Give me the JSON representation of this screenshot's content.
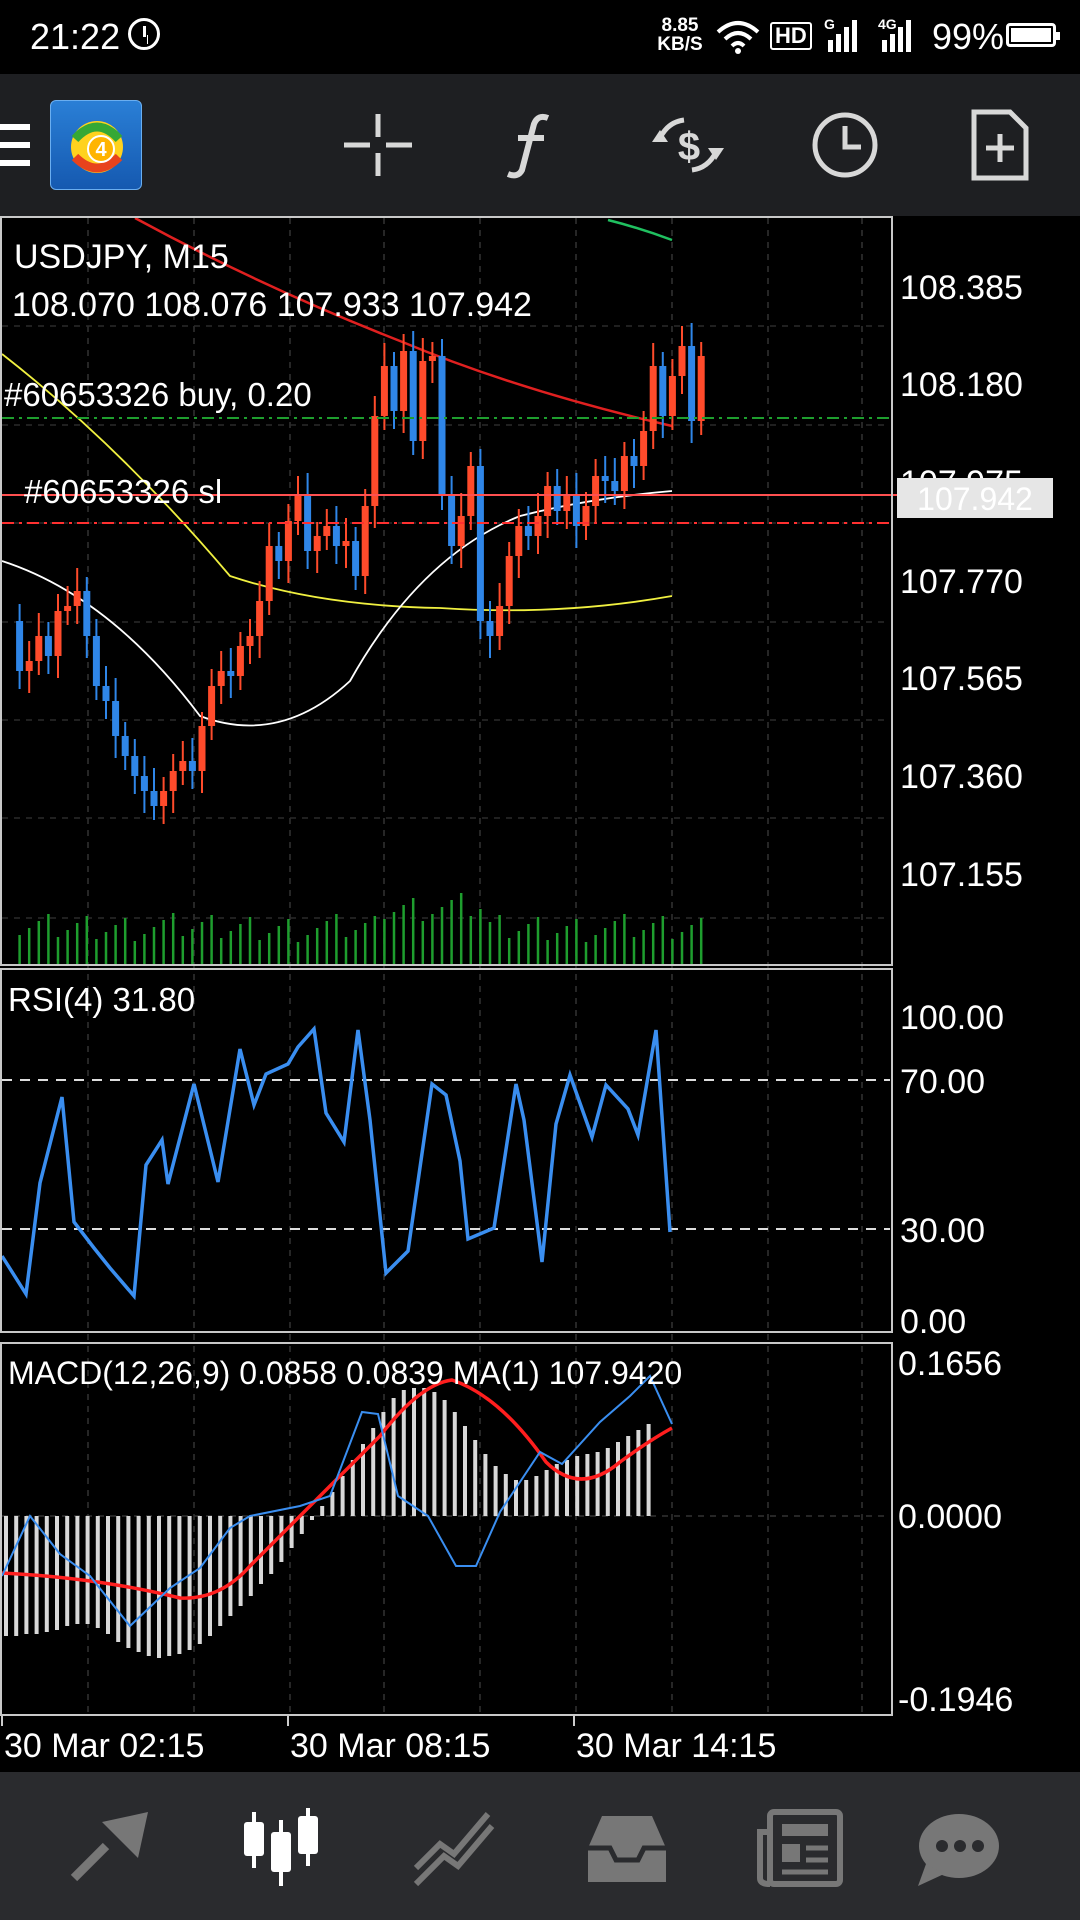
{
  "status_bar": {
    "time": "21:22",
    "net_speed_value": "8.85",
    "net_speed_unit": "KB/S",
    "hd_label": "HD",
    "signal1_label": "G",
    "signal2_label": "4G",
    "battery_percent": "99%"
  },
  "toolbar": {
    "logo_number": "4",
    "icons": [
      "crosshair-icon",
      "function-icon",
      "trade-icon",
      "clock-icon",
      "new-document-icon"
    ]
  },
  "chart": {
    "symbol_timeframe": "USDJPY, M15",
    "ohlc": "108.070 108.076 107.933 107.942",
    "order_buy_label": "#60653326 buy, 0.20",
    "order_sl_label": "#60653326 sl",
    "price_axis": [
      "108.385",
      "108.180",
      "107.975",
      "107.770",
      "107.565",
      "107.360",
      "107.155"
    ],
    "current_price": "107.942",
    "time_axis": [
      "30 Mar 02:15",
      "30 Mar 08:15",
      "30 Mar 14:15"
    ]
  },
  "rsi": {
    "label": "RSI(4) 31.80",
    "axis": [
      "100.00",
      "70.00",
      "30.00",
      "0.00"
    ]
  },
  "macd": {
    "label": "MACD(12,26,9) 0.0858 0.0839 MA(1) 107.9420",
    "axis": [
      "0.1656",
      "0.0000",
      "-0.1946"
    ]
  },
  "colors": {
    "bull": "#ff4b2b",
    "bear": "#2f86e8",
    "ma_red": "#e02020",
    "ma_yellow": "#f0f040",
    "ma_white": "#ffffff",
    "ma_green": "#20c060",
    "volume": "#1e9e2e",
    "rsi_line": "#3a8ef0",
    "macd_hist": "#d8d8d8",
    "macd_signal": "#ff1e1e"
  },
  "bottom_nav": [
    "quotes-icon",
    "chart-icon",
    "trade-icon",
    "history-icon",
    "news-icon",
    "chat-icon"
  ]
}
